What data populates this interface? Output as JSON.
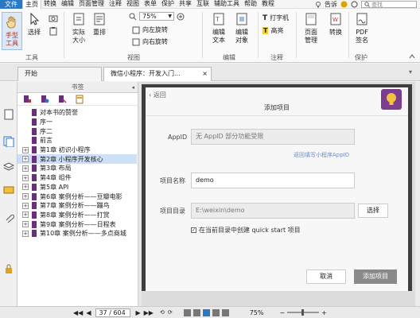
{
  "menu": {
    "file": "文件",
    "items": [
      "主页",
      "转换",
      "编辑",
      "页面管理",
      "注释",
      "视图",
      "表单",
      "保护",
      "共享",
      "互联",
      "辅助工具",
      "帮助",
      "教程"
    ],
    "active_index": 0,
    "right_text": "告诉",
    "search_placeholder": "查找"
  },
  "ribbon": {
    "hand_tool": "手型\n工具",
    "select": "选择",
    "actual_size": "实际\n大小",
    "reflow": "重排",
    "zoom_value": "75%",
    "rotate_left": "向左旋转",
    "rotate_right": "向右旋转",
    "edit_text": "编辑\n文本",
    "edit_object": "编辑\n对象",
    "typewriter": "打字机",
    "highlight": "高亮",
    "page_manage": "页面\n管理",
    "convert": "转换",
    "pdf_sign": "PDF\n签名",
    "group_tools": "工具",
    "group_view": "视图",
    "group_edit": "编辑",
    "group_comment": "注释",
    "group_protect": "保护"
  },
  "tabs": [
    {
      "label": "开始"
    },
    {
      "label": "微信小程序：开发入门..."
    }
  ],
  "bookmarks": {
    "title": "书签",
    "items": [
      {
        "label": "对本书的赞誉",
        "expandable": false,
        "selected": false
      },
      {
        "label": "序一",
        "expandable": false,
        "selected": false
      },
      {
        "label": "序二",
        "expandable": false,
        "selected": false
      },
      {
        "label": "前言",
        "expandable": false,
        "selected": false
      },
      {
        "label": "第1章 初识小程序",
        "expandable": true,
        "selected": false
      },
      {
        "label": "第2章 小程序开发核心",
        "expandable": true,
        "selected": true
      },
      {
        "label": "第3章 布局",
        "expandable": true,
        "selected": false
      },
      {
        "label": "第4章 组件",
        "expandable": true,
        "selected": false
      },
      {
        "label": "第5章 API",
        "expandable": true,
        "selected": false
      },
      {
        "label": "第6章 案例分析——豆瓣电影",
        "expandable": true,
        "selected": false
      },
      {
        "label": "第7章 案例分析——蹦鸟",
        "expandable": true,
        "selected": false
      },
      {
        "label": "第8章 案例分析——打赏",
        "expandable": true,
        "selected": false
      },
      {
        "label": "第9章 案例分析——日程表",
        "expandable": true,
        "selected": false
      },
      {
        "label": "第10章 案例分析——多点商城",
        "expandable": true,
        "selected": false
      }
    ]
  },
  "doc": {
    "back": "返回",
    "title": "添加项目",
    "appid_label": "AppID",
    "appid_value": "无 AppID 部分功能受限",
    "appid_link": "返回填写小程序AppID",
    "name_label": "项目名称",
    "name_value": "demo",
    "dir_label": "项目目录",
    "dir_value": "E:\\weixin\\demo",
    "choose": "选择",
    "checkbox_label": "在当前目录中创建 quick start 项目",
    "checkbox_checked": true,
    "cancel": "取消",
    "add": "添加项目"
  },
  "status": {
    "page": "37 / 604",
    "zoom": "75%"
  },
  "colors": {
    "accent": "#2b78c5",
    "bookmark_flag": "#6b2d7e",
    "selected_row": "#cce0f7"
  }
}
